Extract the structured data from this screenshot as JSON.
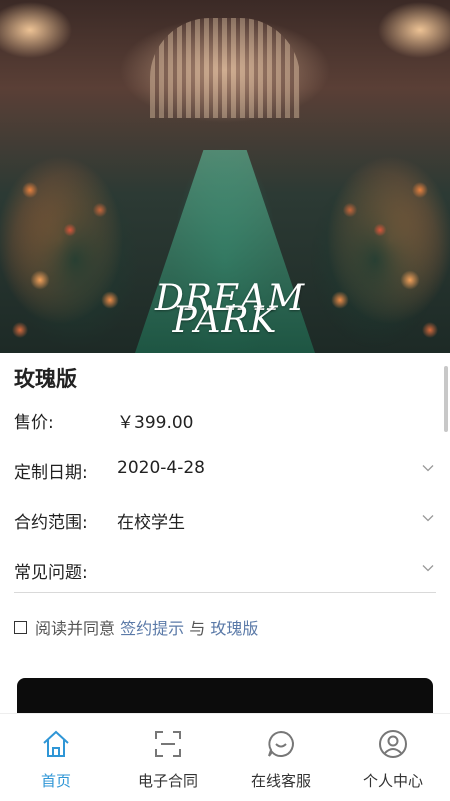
{
  "product": {
    "title": "玫瑰版",
    "price_label": "售价:",
    "price_value": "￥399.00",
    "date_label": "定制日期:",
    "date_value": "2020-4-28",
    "scope_label": "合约范围:",
    "scope_value": "在校学生",
    "faq_label": "常见问题:"
  },
  "hero": {
    "logo_line1": "DREAM",
    "logo_line2": "PARK"
  },
  "agreement": {
    "prefix": "阅读并同意",
    "link1": "签约提示",
    "connector": "与",
    "link2": "玫瑰版"
  },
  "tabbar": {
    "tabs": [
      {
        "label": "首页",
        "icon": "home-icon",
        "active": true
      },
      {
        "label": "电子合同",
        "icon": "scan-icon",
        "active": false
      },
      {
        "label": "在线客服",
        "icon": "chat-icon",
        "active": false
      },
      {
        "label": "个人中心",
        "icon": "user-icon",
        "active": false
      }
    ]
  },
  "colors": {
    "accent": "#2f96d6",
    "link": "#5b7aa8",
    "button": "#0c0c0c"
  }
}
